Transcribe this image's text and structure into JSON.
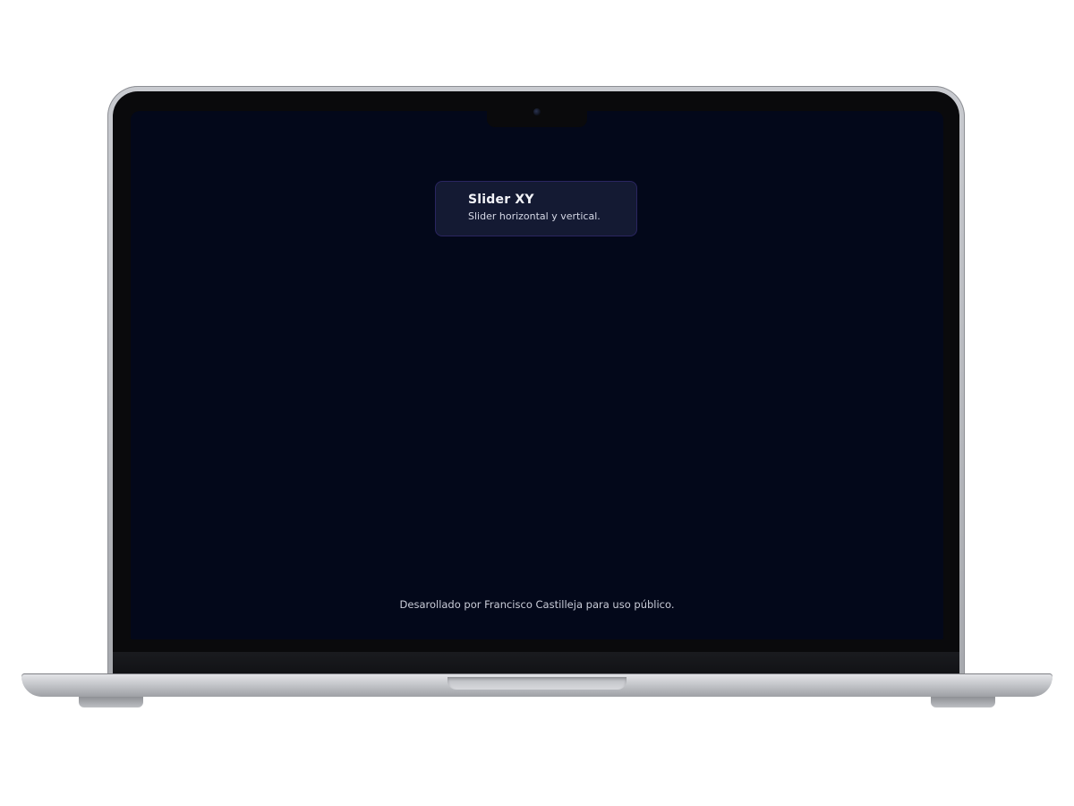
{
  "card": {
    "title": "Slider XY",
    "subtitle": "Slider horizontal y vertical."
  },
  "footer": {
    "text": "Desarollado por Francisco Castilleja para uso público."
  },
  "colors": {
    "screen_background": "#03081a",
    "card_background": "#141a33",
    "card_border": "#2a2560",
    "text_primary": "#f2f3f8",
    "text_secondary": "#c9ccd8"
  }
}
